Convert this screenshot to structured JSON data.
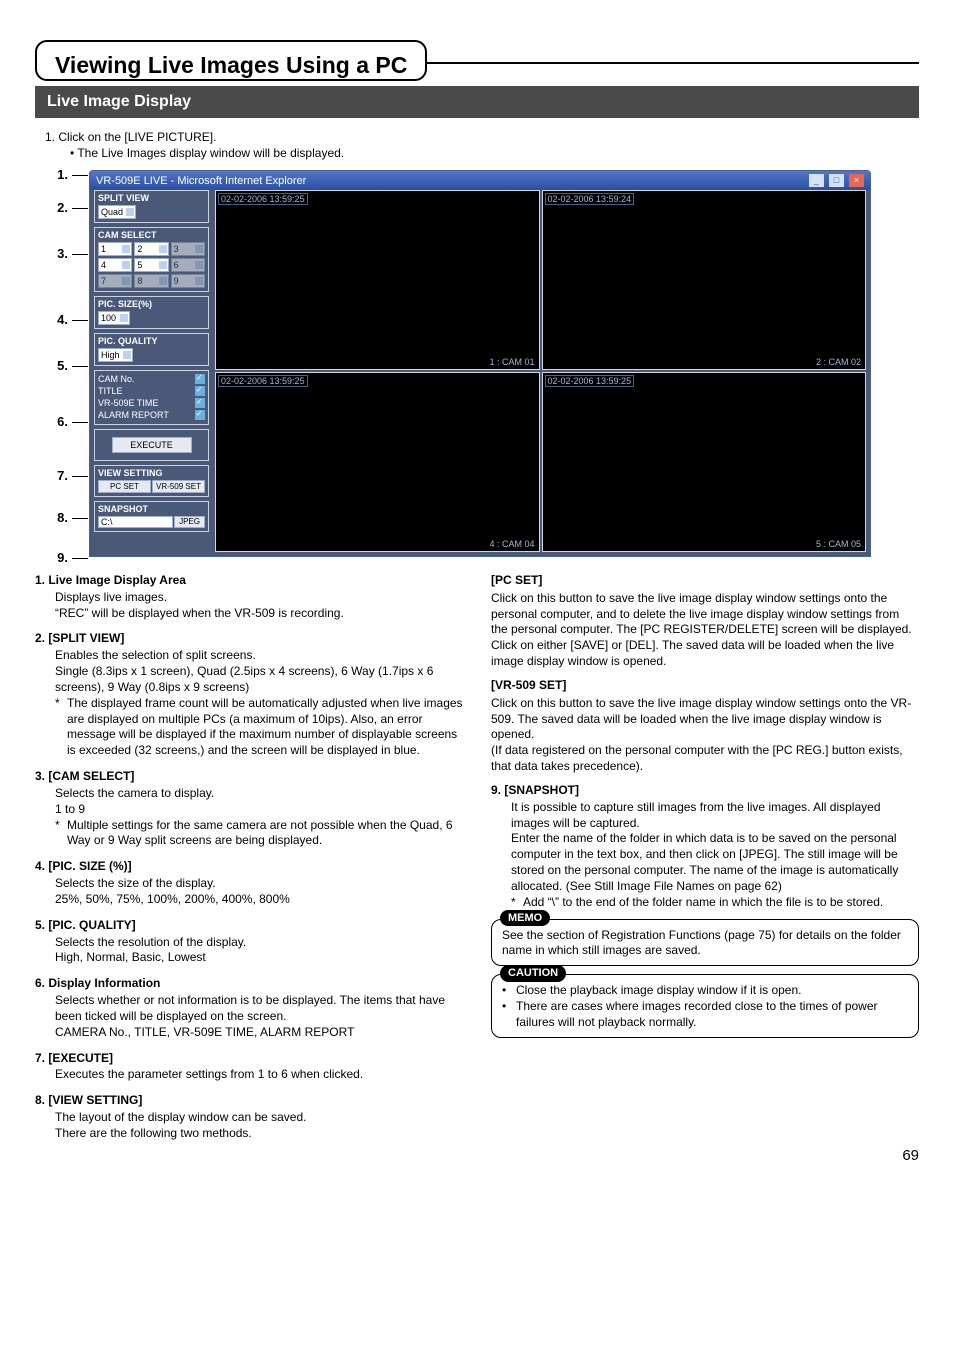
{
  "heading": "Viewing Live Images Using a PC",
  "section": "Live Image Display",
  "step1": {
    "number": "1.",
    "title": "Click on the [LIVE PICTURE].",
    "bullet": "The Live Images display window will be displayed."
  },
  "callouts": [
    "1.",
    "2.",
    "3.",
    "4.",
    "5.",
    "6.",
    "7.",
    "8.",
    "9."
  ],
  "window": {
    "title": "VR-509E LIVE - Microsoft Internet Explorer",
    "splitView": {
      "label": "SPLIT VIEW",
      "value": "Quad"
    },
    "camSelect": {
      "label": "CAM SELECT",
      "options": [
        "1",
        "2",
        "3",
        "4",
        "5",
        "6",
        "7",
        "8",
        "9"
      ]
    },
    "picSize": {
      "label": "PIC. SIZE(%)",
      "value": "100"
    },
    "picQuality": {
      "label": "PIC. QUALITY",
      "value": "High"
    },
    "info": {
      "camNo": "CAM No.",
      "title": "TITLE",
      "time": "VR-509E TIME",
      "alarm": "ALARM REPORT"
    },
    "execute": "EXECUTE",
    "viewSetting": {
      "label": "VIEW SETTING",
      "pcset": "PC SET",
      "vrset": "VR-509 SET"
    },
    "snapshot": {
      "label": "SNAPSHOT",
      "path": "C:\\",
      "btn": "JPEG"
    },
    "cams": [
      {
        "ts": "02-02-2006 13:59:25",
        "label": "1 : CAM 01"
      },
      {
        "ts": "02-02-2006 13:59:24",
        "label": "2 : CAM 02"
      },
      {
        "ts": "02-02-2006 13:59:25",
        "label": "4 : CAM 04"
      },
      {
        "ts": "02-02-2006 13:59:25",
        "label": "5 : CAM 05"
      }
    ]
  },
  "left": {
    "i1": {
      "h": "1.  Live Image Display Area",
      "p1": "Displays live images.",
      "p2": "“REC” will be displayed when the VR-509 is recording."
    },
    "i2": {
      "h": "2.  [SPLIT VIEW]",
      "p1": "Enables the selection of split screens.",
      "p2": "Single (8.3ips x 1 screen), Quad (2.5ips x 4 screens), 6 Way (1.7ips x 6 screens), 9 Way (0.8ips x 9 screens)",
      "n": "The displayed frame count will be automatically adjusted when live images are displayed on multiple PCs (a maximum of 10ips). Also, an error message will be displayed if the maximum number of displayable screens is exceeded (32 screens,) and the screen will be displayed in blue."
    },
    "i3": {
      "h": "3.  [CAM SELECT]",
      "p1": "Selects the camera to display.",
      "p2": "1 to 9",
      "n": "Multiple settings for the same camera are not possible when the Quad, 6 Way or 9 Way split screens are being displayed."
    },
    "i4": {
      "h": "4.  [PIC. SIZE (%)]",
      "p1": "Selects the size of the display.",
      "p2": "25%, 50%, 75%, 100%, 200%, 400%, 800%"
    },
    "i5": {
      "h": "5.  [PIC. QUALITY]",
      "p1": "Selects the resolution of the display.",
      "p2": "High, Normal, Basic, Lowest"
    },
    "i6": {
      "h": "6.  Display Information",
      "p1": "Selects whether or not information is to be displayed. The items that have been ticked will be displayed on the screen.",
      "p2": "CAMERA No., TITLE, VR-509E TIME, ALARM REPORT"
    },
    "i7": {
      "h": "7.  [EXECUTE]",
      "p1": "Executes the parameter settings from 1 to 6 when clicked."
    },
    "i8": {
      "h": "8.  [VIEW SETTING]",
      "p1": "The layout of the display window can be saved.",
      "p2": "There are the following two methods."
    }
  },
  "right": {
    "pcset": {
      "h": "[PC SET]",
      "p": "Click on this button to save the live image display window settings onto the personal computer, and to delete the live image display window settings from the personal computer. The [PC REGISTER/DELETE] screen will be displayed. Click on either [SAVE] or [DEL]. The saved data will be loaded when the live image display window is opened."
    },
    "vrset": {
      "h": "[VR-509 SET]",
      "p1": "Click on this button to save the live image display window settings onto the VR-509. The saved data will be loaded when the live image display window is opened.",
      "p2": "(If data registered on the personal computer with the [PC REG.] button exists, that data takes precedence)."
    },
    "snap": {
      "h": "9.  [SNAPSHOT]",
      "p1": "It is possible to capture still images from the live images. All displayed images will be captured.",
      "p2": "Enter the name of the folder in which data is to be saved on the personal computer in the text box, and then click on [JPEG]. The still image will be stored on the personal computer. The name of the image is automatically allocated. (See Still Image File Names on page 62)",
      "n": "Add “\\” to the end of the folder name in which the file is to be stored."
    },
    "memo": {
      "tag": "MEMO",
      "text": "See the section of Registration Functions (page 75) for details on the folder name in which still images are saved."
    },
    "caution": {
      "tag": "CAUTION",
      "li1": "Close the playback image display window if it is open.",
      "li2": "There are cases where images recorded close to the times of power failures will not playback normally."
    }
  },
  "pageNum": "69"
}
